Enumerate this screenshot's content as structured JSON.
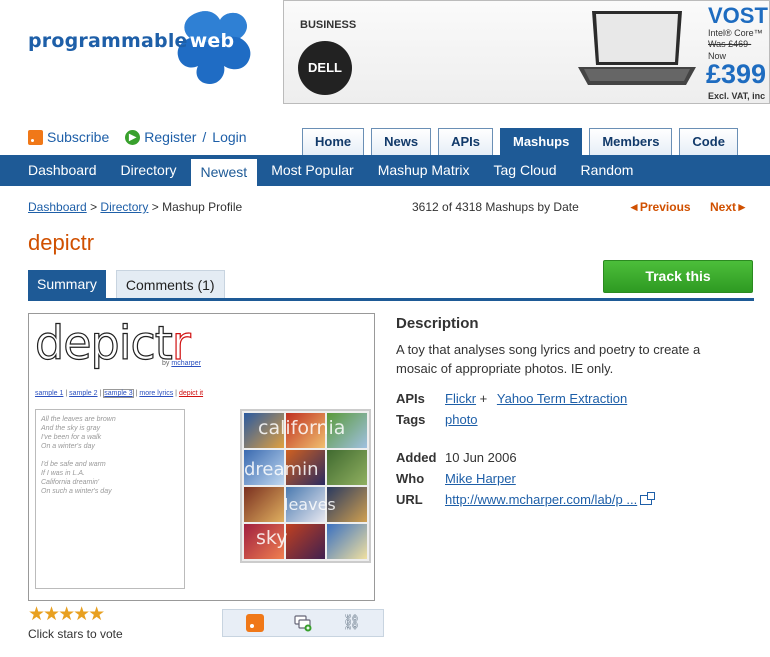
{
  "logo": {
    "text_a": "programmable",
    "text_b": "web"
  },
  "ad": {
    "business": "BUSINESS",
    "brand": "DELL",
    "product": "VOSTR",
    "spec": "Intel® Core™",
    "was": "Was £469-",
    "now": "Now",
    "price": "£399",
    "excl": "Excl. VAT, inc"
  },
  "toplinks": {
    "subscribe": "Subscribe",
    "register": "Register",
    "sep": "/",
    "login": "Login"
  },
  "tabs": [
    "Home",
    "News",
    "APIs",
    "Mashups",
    "Members",
    "Code"
  ],
  "active_tab": "Mashups",
  "subnav": [
    "Dashboard",
    "Directory",
    "Newest",
    "Most Popular",
    "Mashup Matrix",
    "Tag Cloud",
    "Random"
  ],
  "active_subnav": "Newest",
  "breadcrumb": {
    "dashboard": "Dashboard",
    "directory": "Directory",
    "sep": ">",
    "current": "Mashup Profile"
  },
  "pager": {
    "count": "3612 of 4318 Mashups by Date",
    "prev": "◄Previous",
    "next": "Next►"
  },
  "mashup": {
    "title": "depictr",
    "tabs": {
      "summary": "Summary",
      "comments": "Comments (1)"
    },
    "track_label": "Track this",
    "description_heading": "Description",
    "description": "A toy that analyses song lyrics and poetry to create a mosaic of appropriate photos. IE only.",
    "apis_label": "APIs",
    "api_1": "Flickr",
    "api_plus": "+",
    "api_2": "Yahoo Term Extraction",
    "tags_label": "Tags",
    "tag_1": "photo",
    "added_label": "Added",
    "added": "10 Jun 2006",
    "who_label": "Who",
    "who": "Mike Harper",
    "url_label": "URL",
    "url": "http://www.mcharper.com/lab/p ..."
  },
  "screenshot": {
    "logo_a": "depict",
    "logo_b": "r",
    "by": "by",
    "author": "mcharper",
    "links": [
      "sample 1",
      "sample 2",
      "sample 3",
      "more lyrics",
      "depict it"
    ],
    "link_sep": " | ",
    "lyrics": [
      "All the leaves are brown",
      "And the sky is gray",
      "I've been for a walk",
      "On a winter's day",
      "",
      "I'd be safe and warm",
      "If I was in L.A.",
      "California dreamin'",
      "On such a winter's day"
    ],
    "mosaic_words": [
      "california",
      "dreamin",
      "leaves",
      "sky"
    ]
  },
  "rating": {
    "stars": "★★★★★",
    "vote_label": "Click stars to vote"
  },
  "colors": {
    "brand_blue": "#1e5a96",
    "accent_orange": "#d05000",
    "track_green": "#38a02c"
  }
}
